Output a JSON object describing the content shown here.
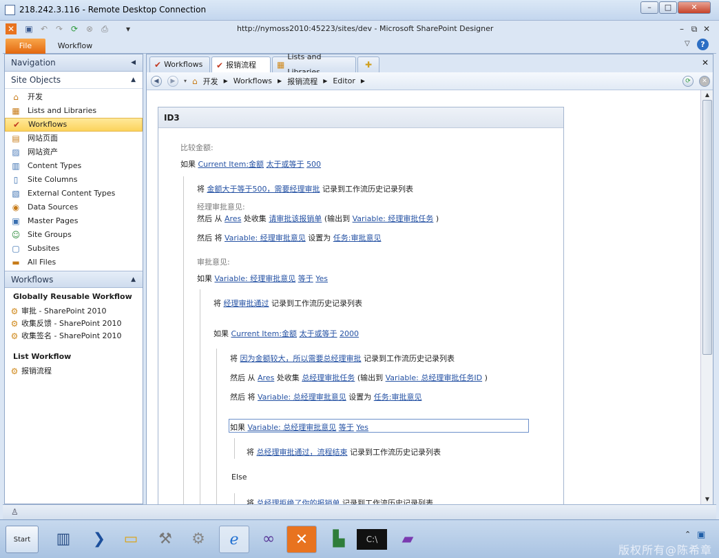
{
  "rdp": {
    "title": "218.242.3.116 - Remote Desktop Connection"
  },
  "spd": {
    "title": "http://nymoss2010:45223/sites/dev  -  Microsoft SharePoint Designer"
  },
  "ribbon": {
    "file": "File",
    "workflow": "Workflow"
  },
  "nav": {
    "header": "Navigation",
    "site_objects": "Site Objects",
    "items": [
      "开发",
      "Lists and Libraries",
      "Workflows",
      "网站页面",
      "网站资产",
      "Content Types",
      "Site Columns",
      "External Content Types",
      "Data Sources",
      "Master Pages",
      "Site Groups",
      "Subsites",
      "All Files"
    ],
    "workflows_header": "Workflows",
    "globally_reusable": "Globally Reusable Workflow",
    "reusable_items": [
      "审批 - SharePoint 2010",
      "收集反馈 - SharePoint 2010",
      "收集签名 - SharePoint 2010"
    ],
    "list_workflow": "List Workflow",
    "list_items": [
      "报销流程"
    ]
  },
  "tabs": [
    "Workflows",
    "报销流程",
    "Lists and Libraries"
  ],
  "breadcrumb": [
    "开发",
    "Workflows",
    "报销流程",
    "Editor"
  ],
  "editor": {
    "step_title": "ID3",
    "l1": "比较金额:",
    "l2a": "如果",
    "l2b": "Current Item:金额",
    "l2c": "太于或等于",
    "l2d": "500",
    "l3a": "将",
    "l3b": "金额大于等于500，需要经理审批",
    "l3c": "记录到工作流历史记录列表",
    "l4": "经理审批意见:",
    "l5a": "然后 从",
    "l5b": "Ares",
    "l5c": "处收集",
    "l5d": "请审批该报销单",
    "l5e": "(输出到",
    "l5f": "Variable: 经理审批任务",
    "l5g": ")",
    "l6a": "然后 将",
    "l6b": "Variable: 经理审批意见",
    "l6c": "设置为",
    "l6d": "任务:审批意见",
    "l7": "审批意见:",
    "l8a": "如果",
    "l8b": "Variable: 经理审批意见",
    "l8c": "等于",
    "l8d": "Yes",
    "l9a": "将",
    "l9b": "经理审批通过",
    "l9c": "记录到工作流历史记录列表",
    "l10a": "如果",
    "l10b": "Current Item:金额",
    "l10c": "太于或等于",
    "l10d": "2000",
    "l11a": "将",
    "l11b": "因为金额较大，所以需要总经理审批",
    "l11c": "记录到工作流历史记录列表",
    "l12a": "然后 从",
    "l12b": "Ares",
    "l12c": "处收集",
    "l12d": "总经理审批任务",
    "l12e": "(输出到",
    "l12f": "Variable: 总经理审批任务ID",
    "l12g": ")",
    "l13a": "然后 将",
    "l13b": "Variable: 总经理审批意见",
    "l13c": "设置为",
    "l13d": "任务:审批意见",
    "l14a": "如果",
    "l14b": "Variable: 总经理审批意见",
    "l14c": "等于",
    "l14d": "Yes",
    "l15a": "将",
    "l15b": "总经理审批通过，流程结束",
    "l15c": "记录到工作流历史记录列表",
    "l16": "Else",
    "l17a": "将",
    "l17b": "总经理拒绝了你的报销单",
    "l17c": "记录到工作流历史记录列表"
  },
  "taskbar": {
    "start": "Start",
    "copyright": "版权所有@陈希章"
  }
}
